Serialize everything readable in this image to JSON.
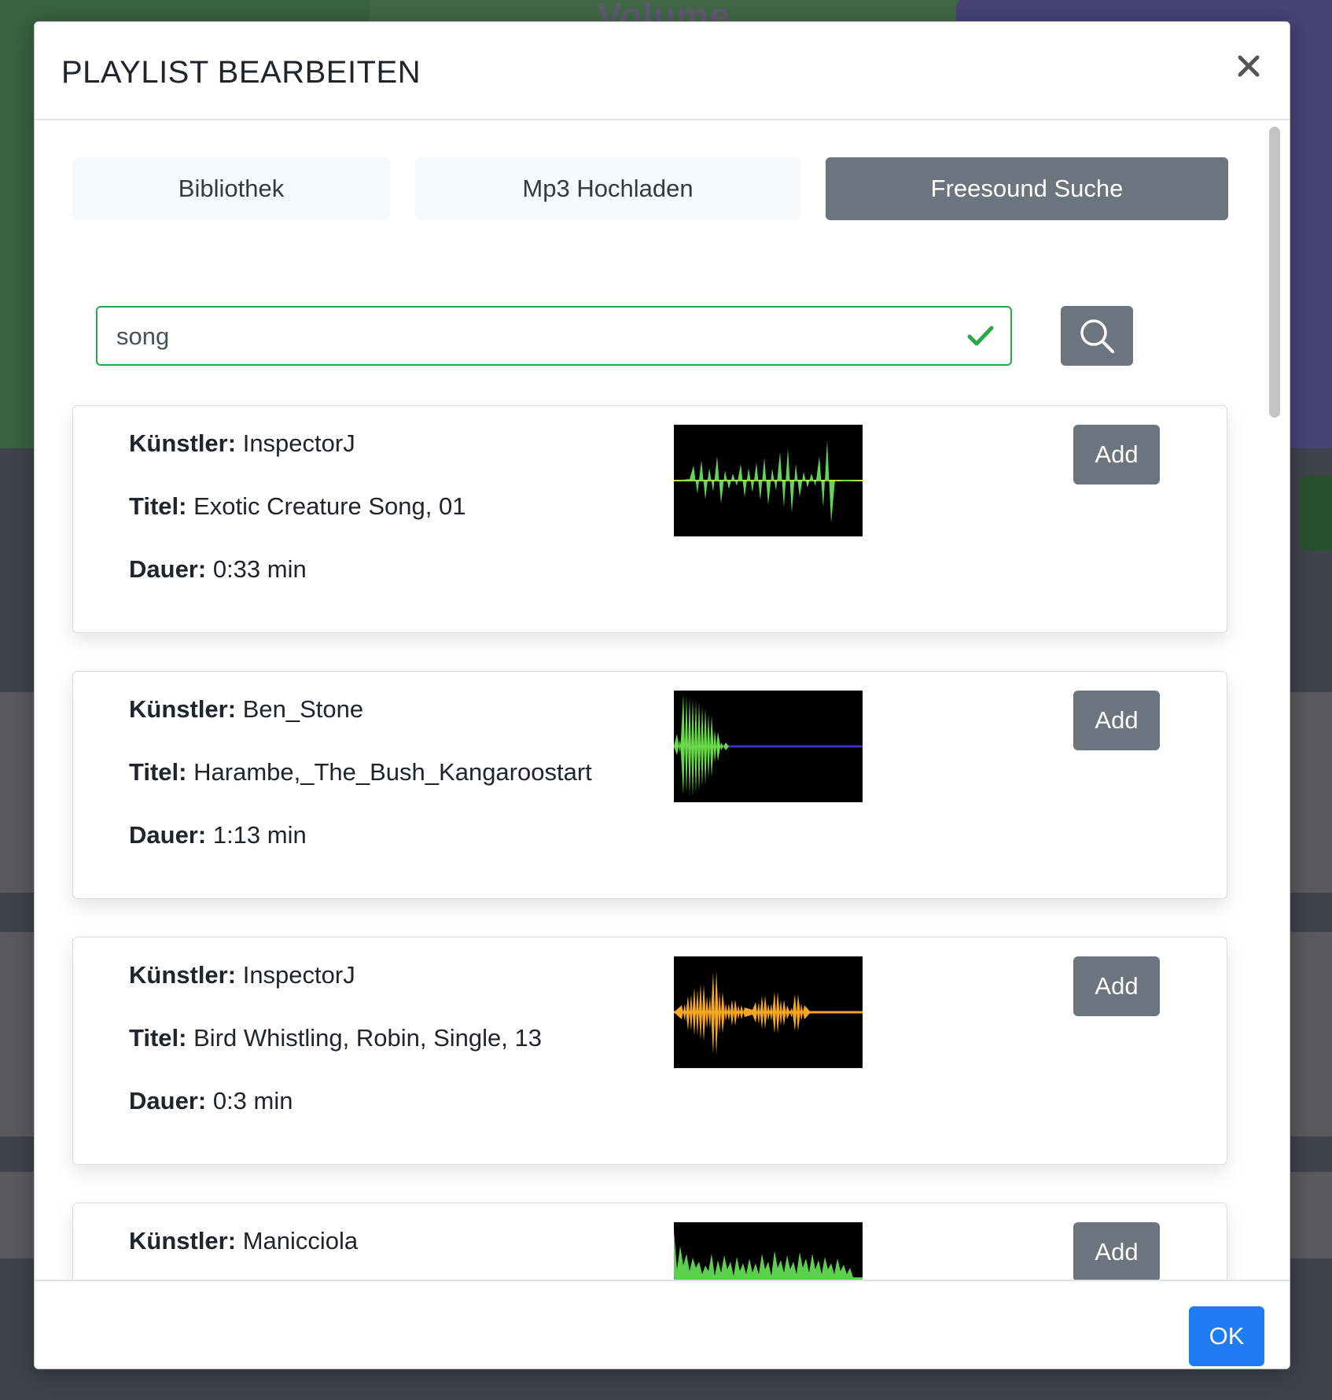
{
  "background": {
    "title_fragment": "Volume"
  },
  "modal": {
    "title": "PLAYLIST BEARBEITEN",
    "close_icon": "close-icon"
  },
  "tabs": [
    {
      "label": "Bibliothek",
      "active": false
    },
    {
      "label": "Mp3 Hochladen",
      "active": false
    },
    {
      "label": "Freesound Suche",
      "active": true
    }
  ],
  "search": {
    "value": "song",
    "valid": true,
    "button_icon": "search-icon"
  },
  "labels": {
    "artist": "Künstler:",
    "title": "Titel:",
    "duration": "Dauer:",
    "add": "Add"
  },
  "results": [
    {
      "artist": "InspectorJ",
      "title": "Exotic Creature Song, 01",
      "duration": "0:33 min",
      "waveform_color": "#62d45a"
    },
    {
      "artist": "Ben_Stone",
      "title": "Harambe,_The_Bush_Kangaroostart",
      "duration": "1:13 min",
      "waveform_color": "#6cd84c"
    },
    {
      "artist": "InspectorJ",
      "title": "Bird Whistling, Robin, Single, 13",
      "duration": "0:3 min",
      "waveform_color": "#f5a623"
    },
    {
      "artist": "Manicciola",
      "title": "",
      "duration": "",
      "waveform_color": "#5ccf4e"
    }
  ],
  "footer": {
    "ok_label": "OK"
  },
  "colors": {
    "active_tab": "#6c757d",
    "valid_border": "#28a745",
    "primary": "#1f7cf6"
  }
}
